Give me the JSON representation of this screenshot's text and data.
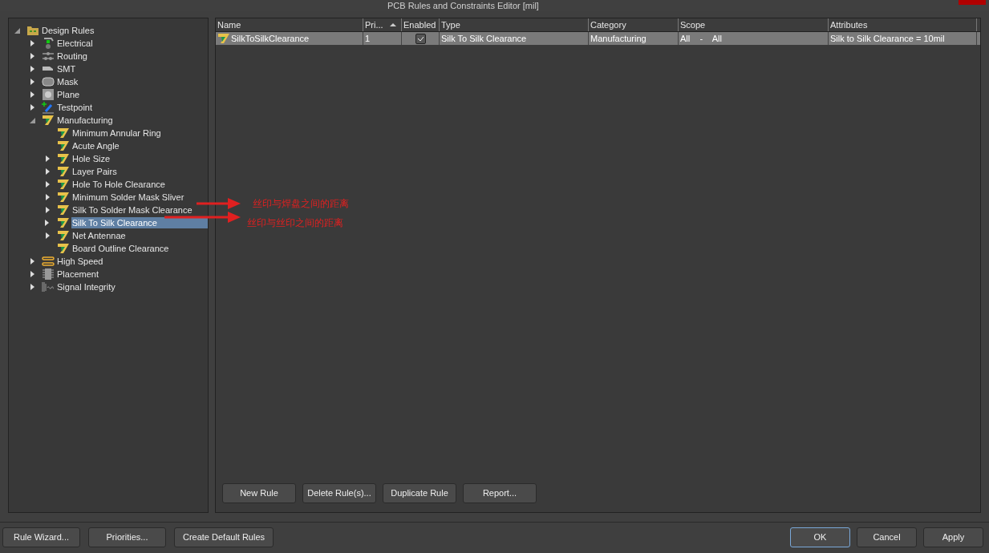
{
  "window": {
    "title": "PCB Rules and Constraints Editor [mil]"
  },
  "tree": [
    {
      "label": "Design Rules",
      "kind": "folder",
      "expandable": true,
      "expanded": true,
      "selected": false,
      "children": [
        {
          "label": "Electrical",
          "kind": "electrical",
          "expandable": true,
          "expanded": false,
          "selected": false
        },
        {
          "label": "Routing",
          "kind": "routing",
          "expandable": true,
          "expanded": false,
          "selected": false
        },
        {
          "label": "SMT",
          "kind": "smt",
          "expandable": true,
          "expanded": false,
          "selected": false
        },
        {
          "label": "Mask",
          "kind": "mask",
          "expandable": true,
          "expanded": false,
          "selected": false
        },
        {
          "label": "Plane",
          "kind": "plane",
          "expandable": true,
          "expanded": false,
          "selected": false
        },
        {
          "label": "Testpoint",
          "kind": "testpoint",
          "expandable": true,
          "expanded": false,
          "selected": false
        },
        {
          "label": "Manufacturing",
          "kind": "rule",
          "expandable": true,
          "expanded": true,
          "selected": false,
          "children": [
            {
              "label": "Minimum Annular Ring",
              "kind": "rule",
              "expandable": false,
              "selected": false
            },
            {
              "label": "Acute Angle",
              "kind": "rule",
              "expandable": false,
              "selected": false
            },
            {
              "label": "Hole Size",
              "kind": "rule",
              "expandable": true,
              "expanded": false,
              "selected": false
            },
            {
              "label": "Layer Pairs",
              "kind": "rule",
              "expandable": true,
              "expanded": false,
              "selected": false
            },
            {
              "label": "Hole To Hole Clearance",
              "kind": "rule",
              "expandable": true,
              "expanded": false,
              "selected": false
            },
            {
              "label": "Minimum Solder Mask Sliver",
              "kind": "rule",
              "expandable": true,
              "expanded": false,
              "selected": false
            },
            {
              "label": "Silk To Solder Mask Clearance",
              "kind": "rule",
              "expandable": true,
              "expanded": false,
              "selected": false
            },
            {
              "label": "Silk To Silk Clearance",
              "kind": "rule",
              "expandable": true,
              "expanded": false,
              "selected": true
            },
            {
              "label": "Net Antennae",
              "kind": "rule",
              "expandable": true,
              "expanded": false,
              "selected": false
            },
            {
              "label": "Board Outline Clearance",
              "kind": "rule",
              "expandable": false,
              "selected": false
            }
          ]
        },
        {
          "label": "High Speed",
          "kind": "highspeed",
          "expandable": true,
          "expanded": false,
          "selected": false
        },
        {
          "label": "Placement",
          "kind": "placement",
          "expandable": true,
          "expanded": false,
          "selected": false
        },
        {
          "label": "Signal Integrity",
          "kind": "signal",
          "expandable": true,
          "expanded": false,
          "selected": false
        }
      ]
    }
  ],
  "table": {
    "columns": [
      {
        "label": "Name",
        "sorted": false
      },
      {
        "label": "Pri...",
        "sorted": true
      },
      {
        "label": "Enabled",
        "sorted": false
      },
      {
        "label": "Type",
        "sorted": false
      },
      {
        "label": "Category",
        "sorted": false
      },
      {
        "label": "Scope",
        "sorted": false
      },
      {
        "label": "Attributes",
        "sorted": false
      }
    ],
    "rows": [
      {
        "selected": true,
        "name": "SilkToSilkClearance",
        "priority": "1",
        "enabled": true,
        "type": "Silk To Silk Clearance",
        "category": "Manufacturing",
        "scope": "All    -    All",
        "attributes": "Silk to Silk Clearance = 10mil"
      }
    ]
  },
  "table_buttons": [
    "New Rule",
    "Delete Rule(s)...",
    "Duplicate Rule",
    "Report..."
  ],
  "footer_left_buttons": [
    "Rule Wizard...",
    "Priorities...",
    "Create Default Rules"
  ],
  "footer_right_buttons": [
    {
      "label": "OK",
      "default": true
    },
    {
      "label": "Cancel",
      "default": false
    },
    {
      "label": "Apply",
      "default": false
    }
  ],
  "annotations": [
    {
      "text": "丝印与焊盘之间的距离"
    },
    {
      "text": "丝印与丝印之间的距离"
    }
  ]
}
